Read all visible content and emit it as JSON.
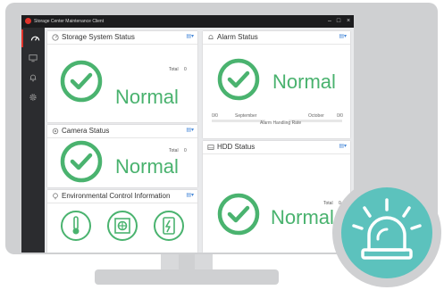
{
  "app": {
    "title": "Storage Center Maintenance Client"
  },
  "window_controls": {
    "minimize": "–",
    "maximize": "□",
    "close": "×"
  },
  "sidebar": {
    "items": [
      "dashboard-icon",
      "monitor-icon",
      "bell-icon",
      "gear-icon"
    ]
  },
  "panels": {
    "storage": {
      "title": "Storage System Status",
      "total_label": "Total",
      "total_value": "0",
      "status": "Normal"
    },
    "alarm": {
      "title": "Alarm Status",
      "status": "Normal",
      "left_value": "0/0",
      "left_month": "September",
      "right_month": "October",
      "right_value": "0/0",
      "handling_label": "Alarm Handling Rate"
    },
    "camera": {
      "title": "Camera Status",
      "total_label": "Total",
      "total_value": "0",
      "status": "Normal"
    },
    "hdd": {
      "title": "HDD Status",
      "total_label": "Total",
      "total_value": "0",
      "status": "Normal"
    },
    "env": {
      "title": "Environmental Control Information",
      "icons": [
        "thermometer-icon",
        "fan-icon",
        "power-icon"
      ]
    }
  },
  "colors": {
    "accent": "#4ab36f",
    "brand": "#e0322a",
    "alarm_badge": "#5cc2bd"
  }
}
